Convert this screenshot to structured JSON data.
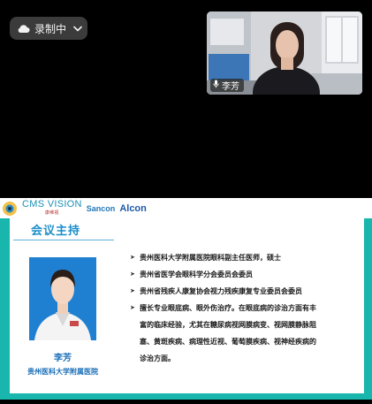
{
  "recording": {
    "label": "录制中",
    "icon": "cloud-icon",
    "dropdown_icon": "chevron-down-icon"
  },
  "participant": {
    "name": "李芳",
    "mic_icon": "microphone-icon"
  },
  "slide": {
    "header": {
      "cms_vision": "CMS VISION",
      "cms_sub": "康维视",
      "sancon": "Sancon",
      "alcon": "Alcon"
    },
    "section_title": "会议主持",
    "speaker_name": "李芳",
    "speaker_affiliation": "贵州医科大学附属医院",
    "bullets": [
      {
        "lines": [
          "贵州医科大学附属医院眼科副主任医师，硕士"
        ]
      },
      {
        "lines": [
          "贵州省医学会眼科学分会委员会委员"
        ]
      },
      {
        "lines": [
          "贵州省残疾人康复协会视力残疾康复专业委员会委员"
        ]
      },
      {
        "lines": [
          "擅长专业眼底病、眼外伤治疗。在眼底病的诊治方面有丰",
          "富的临床经验，尤其在糖尿病视网膜病变、视网膜静脉阻",
          "塞、黄斑疾病、病理性近视、葡萄膜疾病、视神经疾病的",
          "诊治方面。"
        ]
      }
    ],
    "colors": {
      "frame": "#18b6ac",
      "title": "#1d8fc9",
      "name": "#1b6fb8"
    }
  }
}
